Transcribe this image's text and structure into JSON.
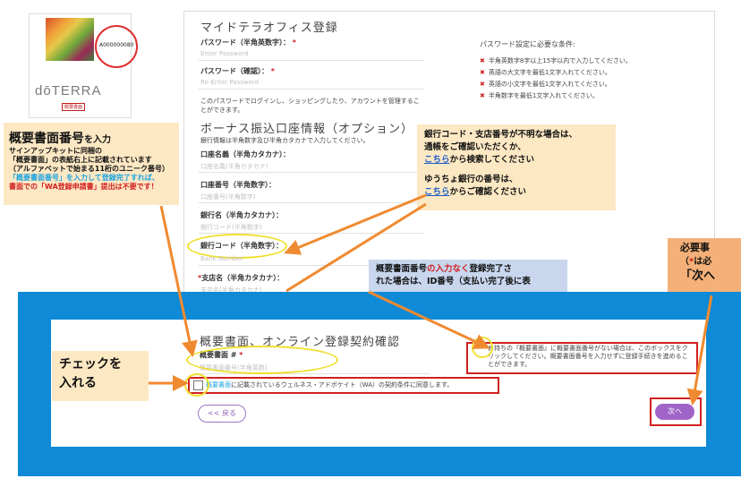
{
  "card": {
    "number": "A000000080",
    "logo": "dōTERRA",
    "tag": "概要書面"
  },
  "form": {
    "title": "マイドテラオフィス登録",
    "password_label": "パスワード（半角英数字）：",
    "password_placeholder": "Enter Password",
    "confirm_label": "パスワード（確認）：",
    "confirm_placeholder": "Re-Enter Password",
    "password_note": "このパスワードでログインし、ショッピングしたり、アカウントを管理することができます。",
    "req_title": "パスワード設定に必要な条件:",
    "requirements": [
      "半角英数字8字以上15字以内で入力してください。",
      "英語の大文字を最低1文字入れてください。",
      "英語の小文字を最低1文字入れてください。",
      "半角数字を最低1文字入れてください。"
    ],
    "bonus_title": "ボーナス振込口座情報（オプション）",
    "bonus_note": "銀行情報は半角数字及び半角カタカナで入力してください。",
    "account_name_label": "口座名義（半角カタカナ）：",
    "account_name_placeholder": "口座名義(半角カタカナ)",
    "account_number_label": "口座番号（半角数字）：",
    "account_number_placeholder": "口座番号(半角数字)",
    "bank_name_label": "銀行名（半角カタカナ）：",
    "bank_name_placeholder": "銀行コード(半角数字)",
    "bank_code_label": "銀行コード（半角数字）：",
    "bank_code_placeholder": "Bank Number",
    "branch_label": "支店名（半角カタカナ）：",
    "branch_placeholder": "支店名(半角カタカナ)"
  },
  "note_left": {
    "heading": "概要書面番号",
    "heading_suffix": "を入力",
    "line1": "サインアップキットに同梱の",
    "line2": "「概要書面」の表紙右上に記載されています",
    "line3": "（アルファベットで始まる11桁のユニーク番号）",
    "line4": "「概要書面番号」を入力して登録完了すれば、",
    "line5": "書面での「WA登録申請書」提出は不要です！"
  },
  "note_right": {
    "line1": "銀行コード・支店番号が不明な場合は、",
    "line2": "通帳をご確認いただくか、",
    "link1": "こちら",
    "line3": "から検索してください",
    "line4": "ゆうちょ銀行の番号は、",
    "link2": "こちら",
    "line5": "からご確認ください"
  },
  "note_mid": {
    "part1": "概要書面番号",
    "part2": "の",
    "part3": "入力なく",
    "part4": "登録完了さ",
    "line2": "れた場合は、ID番号（支払い完了後に表"
  },
  "note_edge": {
    "line1": "必要事",
    "line2a": "（",
    "line2b": "*",
    "line2c": "は必",
    "line3": "「次へ"
  },
  "contract": {
    "title": "概要書面、オンライン登録契約確認",
    "field_label": "概要書面 # ",
    "field_placeholder": "概要書面番号(半角英数)",
    "info_text": "お持ちの『概要書面』に概要書面番号がない場合は、このボックスをクリックしてください。概要書面番号を入力せずに登録手続きを進めることができます。",
    "agree_link": "概要書面",
    "agree_text": "に記載されているウェルネス・アドボケイト（WA）の契約条件に同意します。",
    "back": "<< 戻る",
    "next": "次へ",
    "check_note1": "チェックを",
    "check_note2": "入れる"
  },
  "colors": {
    "panel_blue": "#0e8ad6",
    "callout_orange": "#f08a30",
    "required_red": "#d02020",
    "button_purple": "#a064c8",
    "highlight_yellow": "#f0e030"
  }
}
